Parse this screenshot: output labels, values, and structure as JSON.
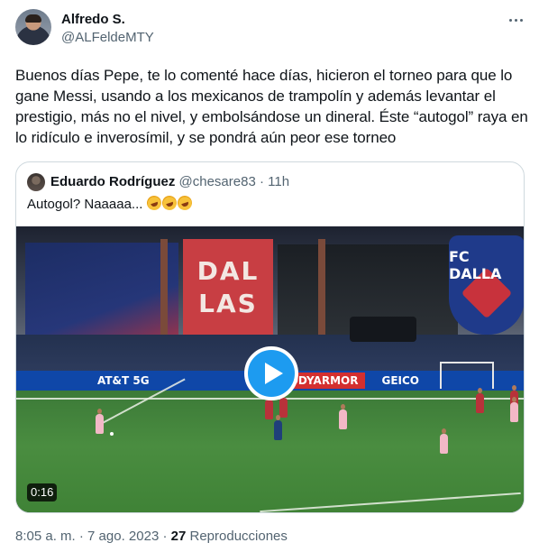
{
  "author": {
    "name": "Alfredo S.",
    "handle": "@ALFeldeMTY",
    "more_icon": "more-horizontal-icon"
  },
  "tweet": {
    "text": "Buenos días Pepe, te lo comenté hace días, hicieron el torneo para que lo gane Messi, usando a los mexicanos de trampolín y además levantar el prestigio, más no el nivel, y embolsándose un dineral. Éste “autogol” raya en lo ridículo e inverosímil, y se pondrá aún peor ese torneo"
  },
  "quoted": {
    "name": "Eduardo Rodríguez",
    "handle": "@chesare83",
    "separator": "·",
    "age": "11h",
    "text": "Autogol? Naaaaa...",
    "emoji_count": 3,
    "emoji_name": "rolling-on-floor-laughing-icon",
    "video": {
      "duration": "0:16",
      "play_icon": "play-icon",
      "tower_lines": [
        "DAL",
        "LAS"
      ],
      "crest_text": "FC DALLA",
      "ad_texts": [
        "AT&T 5G",
        "BODYARMOR",
        "GEICO"
      ]
    }
  },
  "footer": {
    "time": "8:05 a. m.",
    "separator": "·",
    "date": "7 ago. 2023",
    "views_count": "27",
    "views_label": "Reproducciones"
  },
  "colors": {
    "accent": "#1d9bf0",
    "text_primary": "#0f1419",
    "text_secondary": "#536471",
    "border": "#cfd9de"
  }
}
